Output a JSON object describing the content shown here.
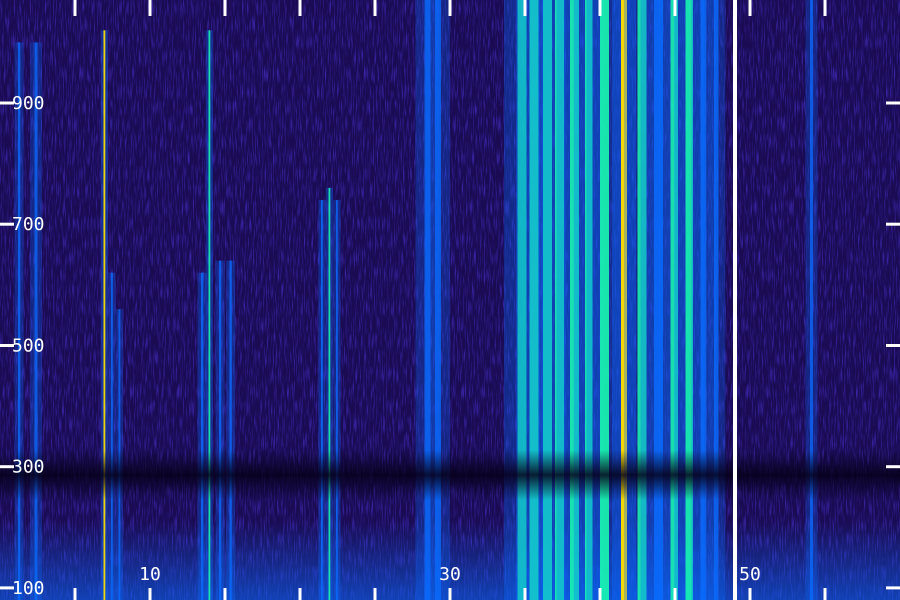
{
  "chart_data": {
    "type": "heatmap",
    "title": "",
    "xlabel": "",
    "ylabel": "",
    "x_ticks": [
      {
        "value": 10,
        "label": "10"
      },
      {
        "value": 30,
        "label": "30"
      },
      {
        "value": 50,
        "label": "50"
      }
    ],
    "y_ticks": [
      {
        "value": 900,
        "label": "900"
      },
      {
        "value": 700,
        "label": "700"
      },
      {
        "value": 500,
        "label": "500"
      },
      {
        "value": 300,
        "label": "300"
      },
      {
        "value": 100,
        "label": "100"
      }
    ],
    "xlim": [
      0,
      60
    ],
    "ylim": [
      80,
      1070
    ],
    "cursor_x": 49,
    "colors": {
      "background": "#1a0b52",
      "low": "#2a20b0",
      "mid": "#0a6cff",
      "high": "#19ffb0",
      "peak": "#ffe000",
      "band_dark": "#050018",
      "tick": "#ffffff"
    },
    "intensity_profile": [
      {
        "x": 1.2,
        "width": 0.15,
        "ymax": 1000,
        "level": 0.55
      },
      {
        "x": 2.3,
        "width": 0.2,
        "ymax": 1000,
        "level": 0.5
      },
      {
        "x": 6.9,
        "width": 0.12,
        "ymax": 1020,
        "level": 0.95
      },
      {
        "x": 7.4,
        "width": 0.12,
        "ymax": 620,
        "level": 0.6
      },
      {
        "x": 7.9,
        "width": 0.12,
        "ymax": 560,
        "level": 0.55
      },
      {
        "x": 13.4,
        "width": 0.15,
        "ymax": 620,
        "level": 0.6
      },
      {
        "x": 13.9,
        "width": 0.12,
        "ymax": 1020,
        "level": 0.75
      },
      {
        "x": 14.6,
        "width": 0.15,
        "ymax": 640,
        "level": 0.55
      },
      {
        "x": 15.3,
        "width": 0.15,
        "ymax": 640,
        "level": 0.6
      },
      {
        "x": 21.4,
        "width": 0.12,
        "ymax": 740,
        "level": 0.65
      },
      {
        "x": 21.9,
        "width": 0.12,
        "ymax": 760,
        "level": 0.7
      },
      {
        "x": 22.4,
        "width": 0.12,
        "ymax": 740,
        "level": 0.6
      },
      {
        "x": 28.3,
        "width": 0.4,
        "ymax": 1070,
        "level": 0.55
      },
      {
        "x": 29.0,
        "width": 0.4,
        "ymax": 1070,
        "level": 0.5
      },
      {
        "x": 34.5,
        "width": 0.6,
        "ymax": 1070,
        "level": 0.7
      },
      {
        "x": 35.3,
        "width": 0.6,
        "ymax": 1070,
        "level": 0.8
      },
      {
        "x": 36.2,
        "width": 0.6,
        "ymax": 1070,
        "level": 0.75
      },
      {
        "x": 37.0,
        "width": 0.6,
        "ymax": 1070,
        "level": 0.7
      },
      {
        "x": 38.0,
        "width": 0.6,
        "ymax": 1070,
        "level": 0.75
      },
      {
        "x": 39.0,
        "width": 0.5,
        "ymax": 1070,
        "level": 0.7
      },
      {
        "x": 40.0,
        "width": 0.6,
        "ymax": 1070,
        "level": 0.8
      },
      {
        "x": 41.4,
        "width": 0.4,
        "ymax": 1070,
        "level": 1.0
      },
      {
        "x": 42.5,
        "width": 0.6,
        "ymax": 1070,
        "level": 0.7
      },
      {
        "x": 43.6,
        "width": 0.6,
        "ymax": 1070,
        "level": 0.65
      },
      {
        "x": 44.7,
        "width": 0.5,
        "ymax": 1070,
        "level": 0.7
      },
      {
        "x": 45.7,
        "width": 0.5,
        "ymax": 1070,
        "level": 0.75
      },
      {
        "x": 46.7,
        "width": 0.4,
        "ymax": 1070,
        "level": 0.65
      },
      {
        "x": 47.6,
        "width": 0.3,
        "ymax": 1070,
        "level": 0.6
      },
      {
        "x": 54.0,
        "width": 0.2,
        "ymax": 1070,
        "level": 0.5
      }
    ]
  }
}
